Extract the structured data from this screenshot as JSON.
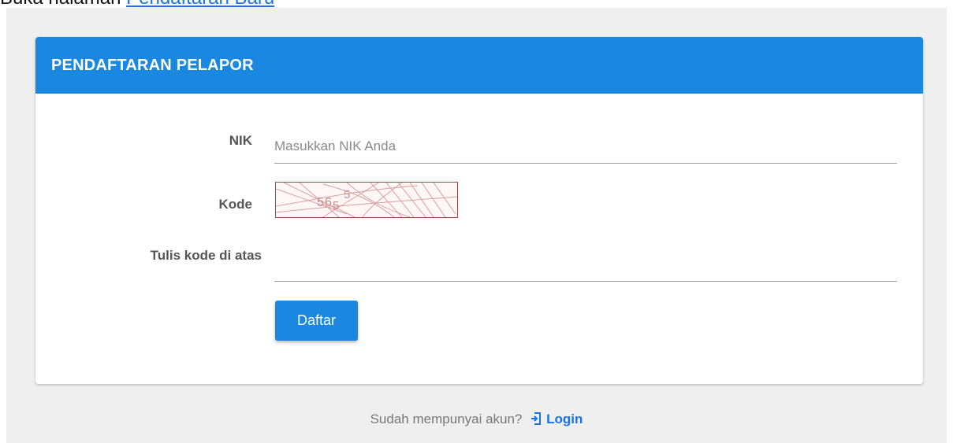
{
  "top_notice": {
    "prefix": "Buka halaman ",
    "link": "Pendaftaran Baru"
  },
  "card": {
    "title": "PENDAFTARAN PELAPOR"
  },
  "form": {
    "nik_label": "NIK",
    "nik_placeholder": "Masukkan NIK Anda",
    "nik_value": "",
    "kode_label": "Kode",
    "captcha_text": "565 5",
    "tulis_label": "Tulis kode di atas",
    "tulis_value": "",
    "submit_label": "Daftar"
  },
  "footer": {
    "question": "Sudah mempunyai akun?",
    "login_icon": "login-icon",
    "login_label": "Login"
  },
  "colors": {
    "primary": "#1a88e0",
    "background": "#efefef",
    "link": "#1a73e8"
  }
}
